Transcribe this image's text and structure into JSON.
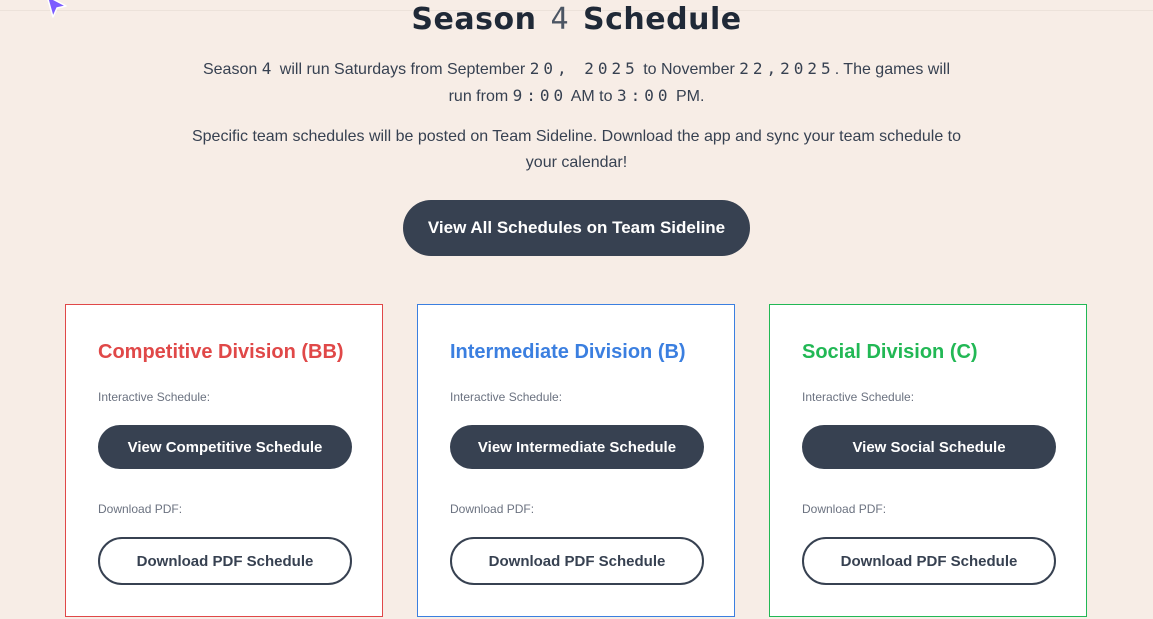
{
  "header": {
    "title_pre": "Season",
    "title_num": "4",
    "title_post": "Schedule"
  },
  "intro": {
    "p1_a": "Season",
    "p1_season": "4",
    "p1_b": "will run Saturdays from September",
    "p1_start": "20, 2025",
    "p1_c": "to November",
    "p1_end": "22,2025",
    "p1_d": ". The games will run from",
    "p1_time1": "9:00",
    "p1_e": "AM to",
    "p1_time2": "3:00",
    "p1_f": "PM.",
    "p2": "Specific team schedules will be posted on Team Sideline. Download the app and sync your team schedule to your calendar!"
  },
  "main_button": "View All Schedules on Team Sideline",
  "divisions": [
    {
      "title": "Competitive Division (BB)",
      "color": "#e04848",
      "interactive_label": "Interactive Schedule:",
      "view_button": "View Competitive Schedule",
      "pdf_label": "Download PDF:",
      "pdf_button": "Download PDF Schedule"
    },
    {
      "title": "Intermediate Division (B)",
      "color": "#3b7fe0",
      "interactive_label": "Interactive Schedule:",
      "view_button": "View Intermediate Schedule",
      "pdf_label": "Download PDF:",
      "pdf_button": "Download PDF Schedule"
    },
    {
      "title": "Social Division (C)",
      "color": "#22b855",
      "interactive_label": "Interactive Schedule:",
      "view_button": "View Social Schedule",
      "pdf_label": "Download PDF:",
      "pdf_button": "Download PDF Schedule"
    }
  ],
  "colors": {
    "background": "#f7ede6",
    "button_dark": "#374151",
    "cursor": "#7c5cff"
  },
  "icons": {
    "cursor": "pointer-cursor-icon"
  }
}
